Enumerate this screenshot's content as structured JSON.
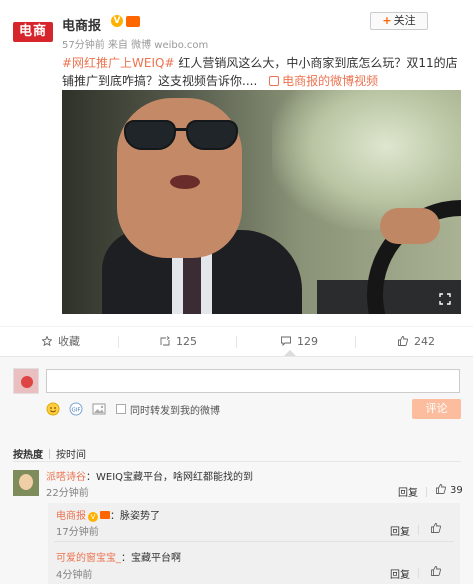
{
  "post": {
    "author": "电商报",
    "logo_text": "电商报",
    "verified_icon": "verified-v-icon",
    "meta": "57分钟前 来自 微博 weibo.com",
    "follow_label": "关注",
    "hashtag": "#网红推广上WEIQ#",
    "text": "红人营销风这么大，中小商家到底怎么玩？双11的店铺推广到底咋搞？这支视频告诉你....",
    "video_link": "电商报的微博视频"
  },
  "actions": {
    "collect": "收藏",
    "repost": "125",
    "comment": "129",
    "like": "242"
  },
  "comment_form": {
    "placeholder": "",
    "also_repost_label": "同时转发到我的微博",
    "submit_label": "评论"
  },
  "sort": {
    "by_hot": "按热度",
    "by_time": "按时间"
  },
  "comments": [
    {
      "user": "派嗒诗谷",
      "text": "：WEIQ宝藏平台，啥网红都能找的到",
      "time": "22分钟前",
      "reply_label": "回复",
      "likes": "39"
    }
  ],
  "replies": [
    {
      "user": "电商报",
      "text": "：脉姿势了",
      "time": "17分钟前",
      "reply_label": "回复",
      "like_label": ""
    },
    {
      "user": "可爱的窗宝宝_",
      "text": "：宝藏平台啊",
      "time": "4分钟前",
      "reply_label": "回复",
      "like_label": ""
    }
  ],
  "colors": {
    "accent": "#eb7350",
    "brand_red": "#d6262b",
    "submit_disabled": "#fbbd9e"
  }
}
